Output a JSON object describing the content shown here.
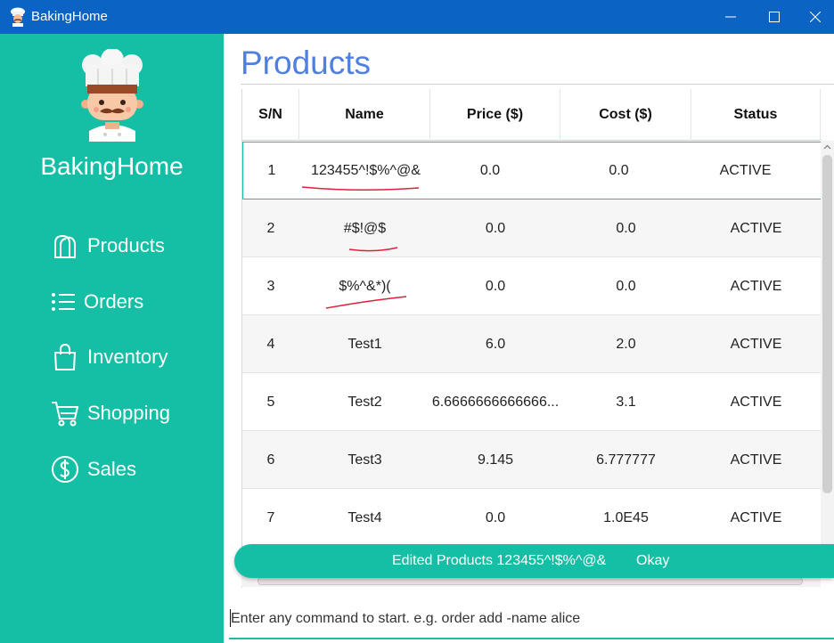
{
  "window": {
    "title": "BakingHome"
  },
  "sidebar": {
    "brand": "BakingHome",
    "items": [
      {
        "label": "Products",
        "icon": "bread-icon"
      },
      {
        "label": "Orders",
        "icon": "list-icon"
      },
      {
        "label": "Inventory",
        "icon": "bag-icon"
      },
      {
        "label": "Shopping",
        "icon": "cart-icon"
      },
      {
        "label": "Sales",
        "icon": "dollar-icon"
      }
    ]
  },
  "main": {
    "title": "Products",
    "table": {
      "headers": [
        "S/N",
        "Name",
        "Price ($)",
        "Cost ($)",
        "Status"
      ],
      "rows": [
        [
          "1",
          "123455^!$%^@&",
          "0.0",
          "0.0",
          "ACTIVE"
        ],
        [
          "2",
          "#$!@$",
          "0.0",
          "0.0",
          "ACTIVE"
        ],
        [
          "3",
          "$%^&*)(",
          "0.0",
          "0.0",
          "ACTIVE"
        ],
        [
          "4",
          "Test1",
          "6.0",
          "2.0",
          "ACTIVE"
        ],
        [
          "5",
          "Test2",
          "6.6666666666666...",
          "3.1",
          "ACTIVE"
        ],
        [
          "6",
          "Test3",
          "9.145",
          "6.777777",
          "ACTIVE"
        ],
        [
          "7",
          "Test4",
          "0.0",
          "1.0E45",
          "ACTIVE"
        ]
      ]
    },
    "toast": {
      "message": "Edited Products 123455^!$%^@&",
      "action": "Okay"
    },
    "command": {
      "placeholder": "Enter any command to start. e.g. order add -name alice"
    }
  },
  "colors": {
    "titlebar": "#0b63c4",
    "accent": "#14bfa5",
    "page_title": "#4f7fe0",
    "annotation_red": "#e0203a"
  }
}
